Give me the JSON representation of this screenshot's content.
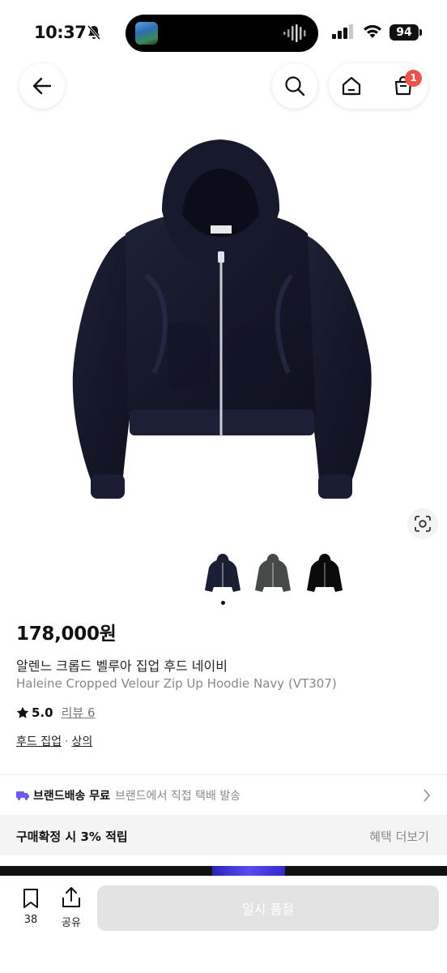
{
  "status_bar": {
    "time": "10:37",
    "battery": "94"
  },
  "nav": {
    "cart_badge": "1"
  },
  "product": {
    "price": "178,000원",
    "name_ko": "알렌느 크롭드 벨루아 집업 후드 네이비",
    "name_en": "Haleine Cropped Velour Zip Up Hoodie Navy (VT307)",
    "rating": "5.0",
    "reviews_label": "리뷰 6",
    "category_1": "후드 집업",
    "category_sep": "·",
    "category_2": "상의",
    "color_options": [
      {
        "name": "navy",
        "color": "#1b1f33"
      },
      {
        "name": "charcoal-green",
        "color": "#444a45"
      },
      {
        "name": "black",
        "color": "#0b0b0c"
      }
    ]
  },
  "shipping": {
    "label": "브랜드배송 무료",
    "desc": "브랜드에서 직접 택배 발송"
  },
  "points": {
    "label": "구매확정 시 3% 적립",
    "more": "혜택 더보기"
  },
  "bottom_bar": {
    "save_count": "38",
    "share_label": "공유",
    "soldout_label": "일시 품절"
  },
  "colors": {
    "accent_purple": "#6b5bf0",
    "badge_red": "#f0524b",
    "disabled_button": "#e3e3e3"
  }
}
